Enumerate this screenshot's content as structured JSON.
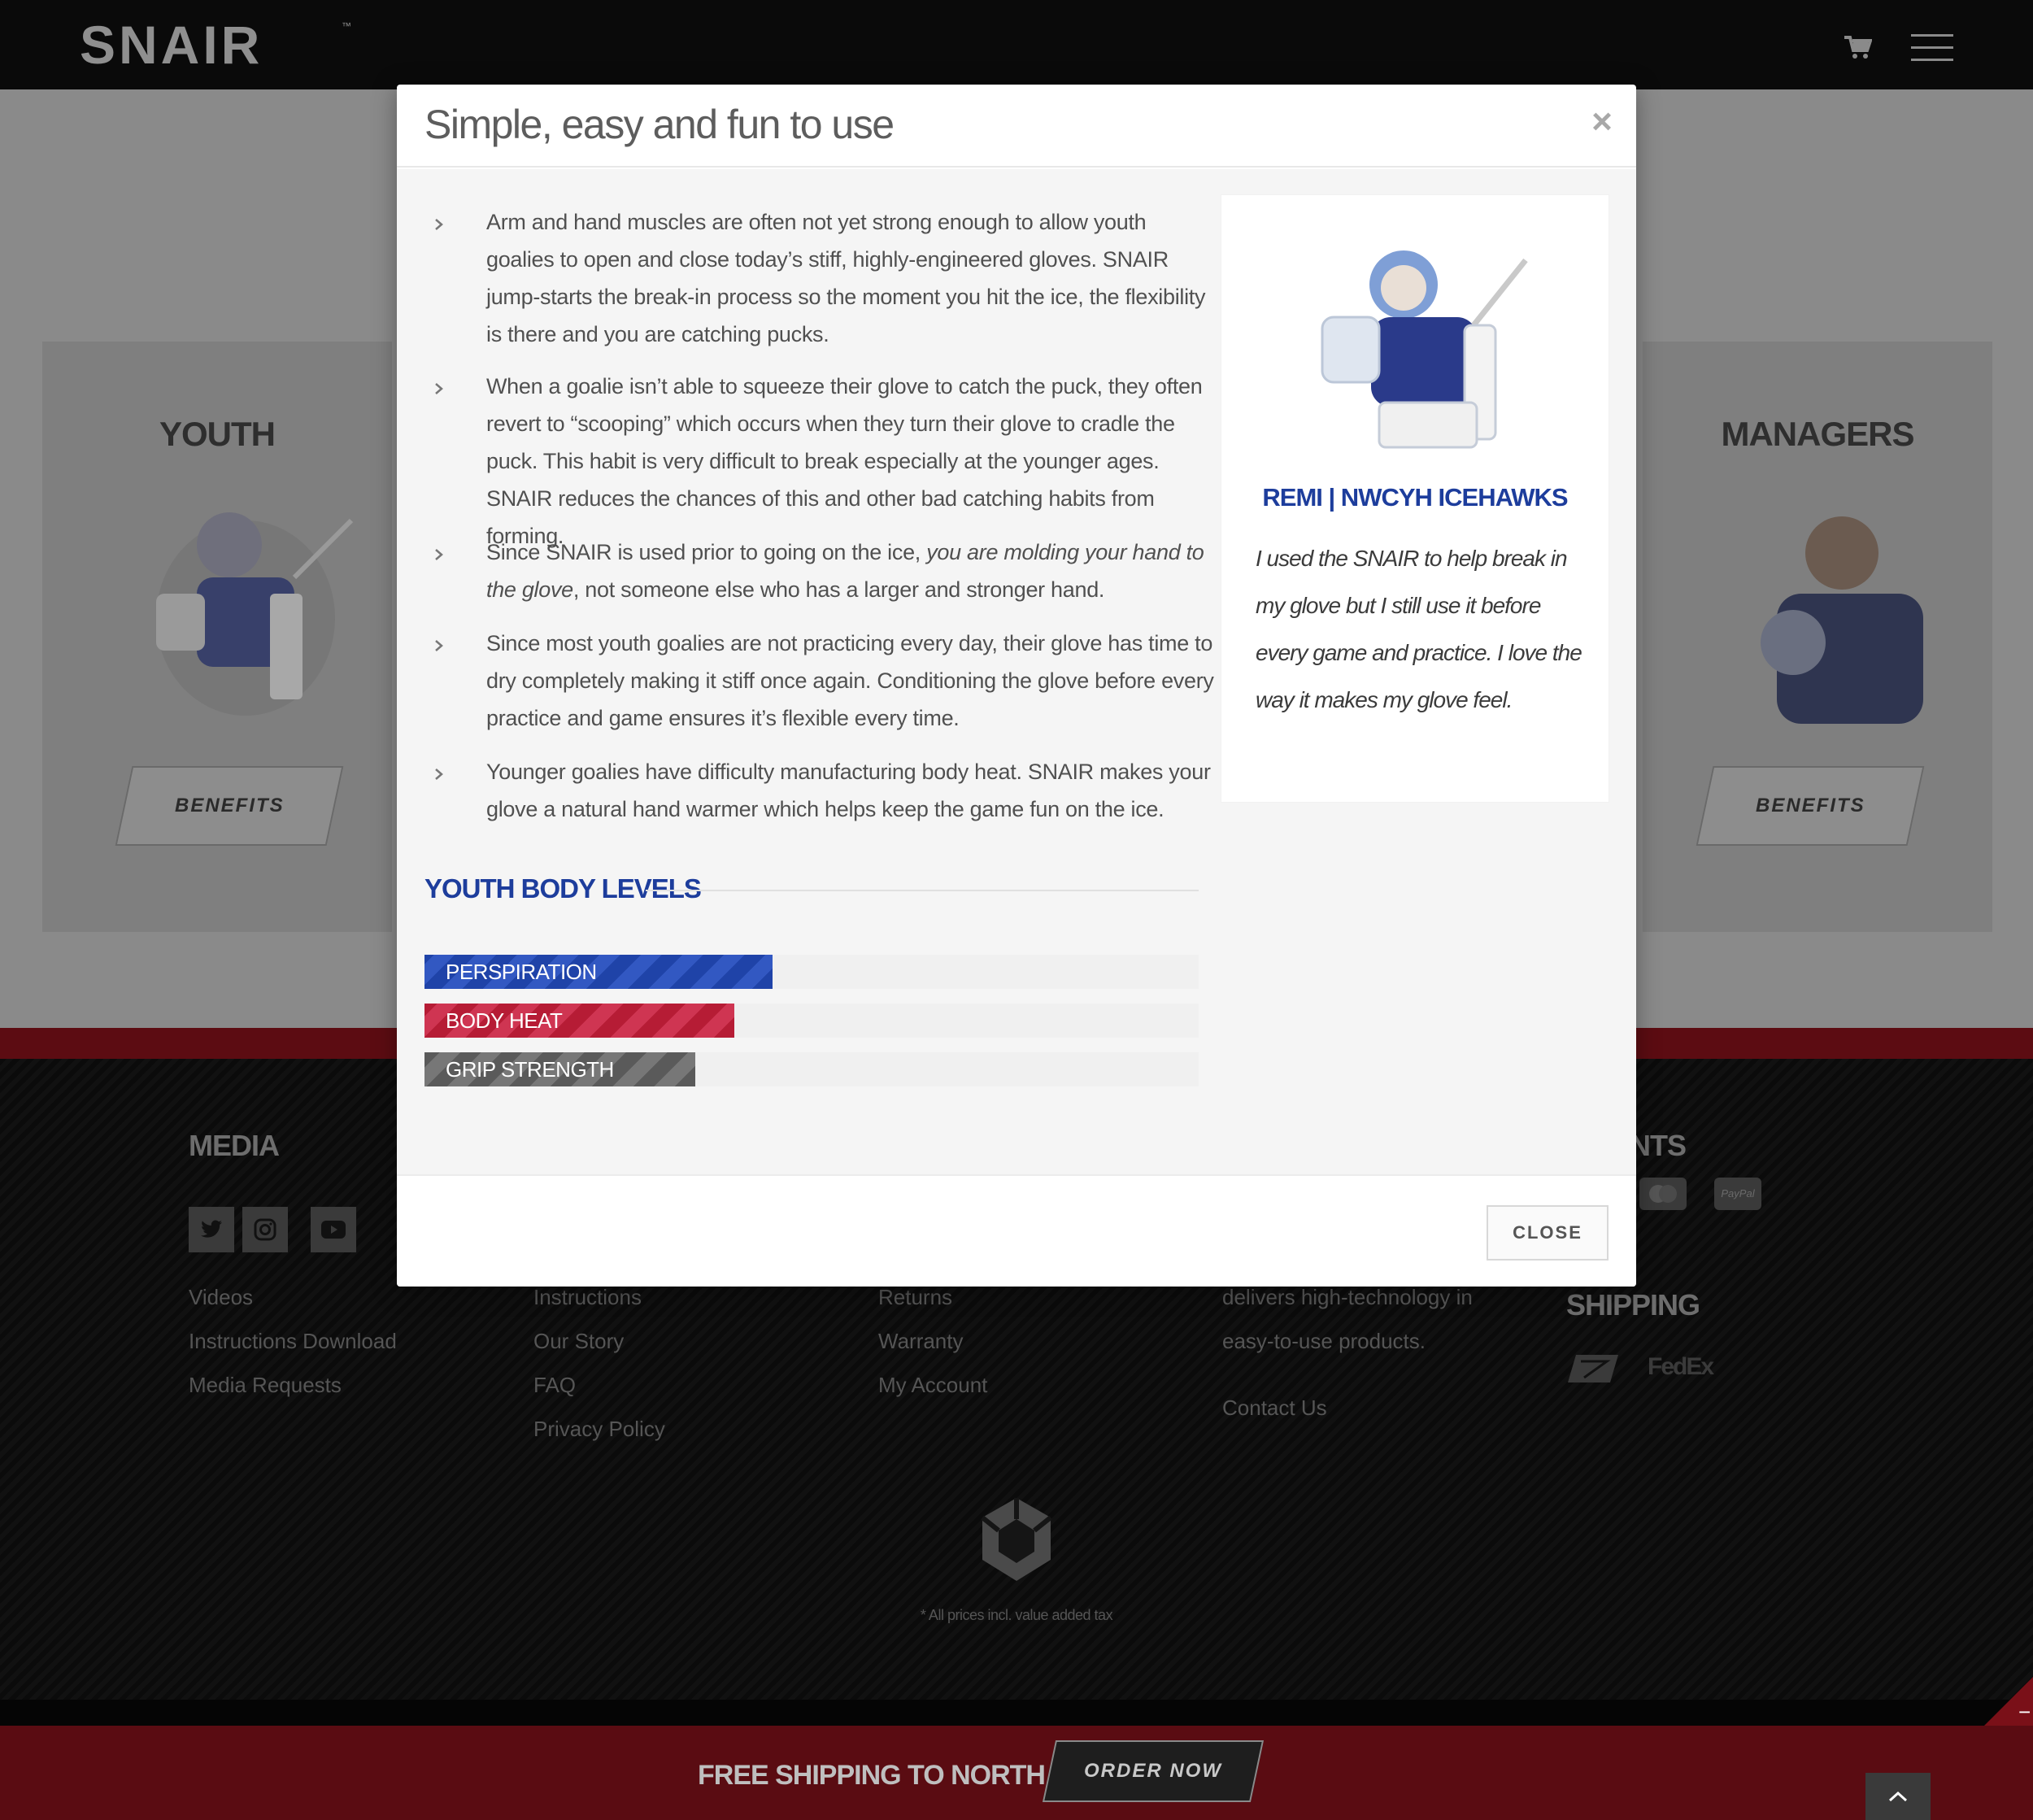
{
  "header": {
    "logo_text": "SNAIR",
    "logo_tm": "™",
    "cart_icon": "cart-icon",
    "menu_icon": "hamburger-icon"
  },
  "page": {
    "cards": [
      {
        "title": "YOUTH",
        "button": "BENEFITS"
      },
      {
        "title": "MANAGERS",
        "button": "BENEFITS"
      }
    ]
  },
  "modal": {
    "title": "Simple, easy and fun to use",
    "close_x": "×",
    "bullets": [
      {
        "text": "Arm and hand muscles are often not yet strong enough to allow youth goalies to open and close today’s stiff, highly-engineered gloves. SNAIR jump-starts the break-in process so the moment you hit the ice, the flexibility is there and you are catching pucks."
      },
      {
        "text": "When a goalie isn’t able to squeeze their glove to catch the puck, they often revert to “scooping” which occurs when they turn their glove to cradle the puck. This habit is very difficult to break especially at the younger ages. SNAIR reduces the chances of this and other bad catching habits from forming."
      },
      {
        "text_before": "Since SNAIR is used prior to going on the ice, ",
        "text_em": "you are molding your hand to the glove",
        "text_after": ", not someone else who has a larger and stronger hand."
      },
      {
        "text": "Since most youth goalies are not practicing every day, their glove has time to dry completely making it stiff once again. Conditioning the glove before every practice and game ensures it’s flexible every time."
      },
      {
        "text": "Younger goalies have difficulty manufacturing body heat. SNAIR makes your glove a natural hand warmer which helps keep the game fun on the ice."
      }
    ],
    "testimonial": {
      "name": "REMI | NWCYH ICEHAWKS",
      "quote": "I used the SNAIR to help break in my glove but I still use it before every game and practice. I love the way it makes my glove feel."
    },
    "levels": {
      "title": "YOUTH BODY LEVELS",
      "items": [
        {
          "label": "PERSPIRATION",
          "percent": 45,
          "color": "#1f43a8"
        },
        {
          "label": "BODY HEAT",
          "percent": 40,
          "color": "#b61c35"
        },
        {
          "label": "GRIP STRENGTH",
          "percent": 35,
          "color": "#5a5a5a"
        }
      ]
    },
    "close_button": "CLOSE"
  },
  "footer": {
    "media_heading": "MEDIA",
    "payments_heading": "NTS",
    "shipping_heading": "SHIPPING",
    "social_icons": [
      "twitter-icon",
      "instagram-icon",
      "youtube-icon"
    ],
    "col1": [
      "Videos",
      "Instructions Download",
      "Media Requests"
    ],
    "col2": [
      "Instructions",
      "Our Story",
      "FAQ",
      "Privacy Policy"
    ],
    "col3": [
      "Returns",
      "Warranty",
      "My Account"
    ],
    "col4_text": [
      "delivers high-technology in",
      "easy-to-use products."
    ],
    "col4_link": "Contact Us",
    "payment_paypal": "PayPal",
    "shipping_fedex": "FedEx",
    "tax_note": "* All prices incl. value added tax"
  },
  "bottom_bar": {
    "promo": "FREE SHIPPING TO NORTH AMERICA",
    "order_button": "ORDER NOW",
    "corner_symbol": "−"
  }
}
